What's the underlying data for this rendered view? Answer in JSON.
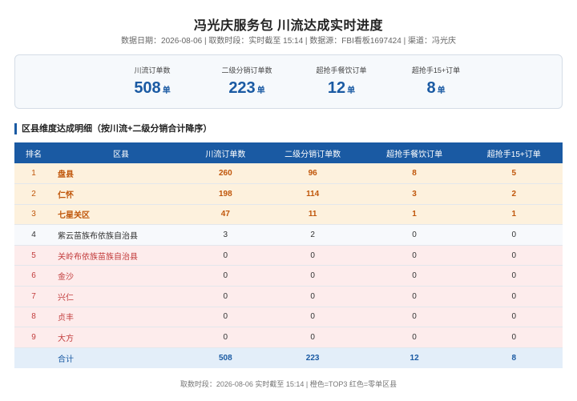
{
  "header": {
    "title": "冯光庆服务包 川流达成实时进度",
    "meta": "数据日期：2026-08-06 | 取数时段：实时截至 15:14 | 数据源：FBI看板1697424 | 渠道：冯光庆"
  },
  "kpis": [
    {
      "label": "川流订单数",
      "value": "508",
      "unit": "单"
    },
    {
      "label": "二级分销订单数",
      "value": "223",
      "unit": "单"
    },
    {
      "label": "超抢手餐饮订单",
      "value": "12",
      "unit": "单"
    },
    {
      "label": "超抢手15+订单",
      "value": "8",
      "unit": "单"
    }
  ],
  "section": {
    "title": "区县维度达成明细（按川流+二级分销合计降序）"
  },
  "table": {
    "headers": [
      "排名",
      "区县",
      "川流订单数",
      "二级分销订单数",
      "超抢手餐饮订单",
      "超抢手15+订单"
    ],
    "rows": [
      {
        "rank": "1",
        "name": "盘县",
        "c1": "260",
        "c2": "96",
        "c3": "8",
        "c4": "5",
        "type": "top3"
      },
      {
        "rank": "2",
        "name": "仁怀",
        "c1": "198",
        "c2": "114",
        "c3": "3",
        "c4": "2",
        "type": "top3"
      },
      {
        "rank": "3",
        "name": "七星关区",
        "c1": "47",
        "c2": "11",
        "c3": "1",
        "c4": "1",
        "type": "top3"
      },
      {
        "rank": "4",
        "name": "紫云苗族布依族自治县",
        "c1": "3",
        "c2": "2",
        "c3": "0",
        "c4": "0",
        "type": "normal"
      },
      {
        "rank": "5",
        "name": "关岭布依族苗族自治县",
        "c1": "0",
        "c2": "0",
        "c3": "0",
        "c4": "0",
        "type": "zero"
      },
      {
        "rank": "6",
        "name": "金沙",
        "c1": "0",
        "c2": "0",
        "c3": "0",
        "c4": "0",
        "type": "zero"
      },
      {
        "rank": "7",
        "name": "兴仁",
        "c1": "0",
        "c2": "0",
        "c3": "0",
        "c4": "0",
        "type": "zero"
      },
      {
        "rank": "8",
        "name": "贞丰",
        "c1": "0",
        "c2": "0",
        "c3": "0",
        "c4": "0",
        "type": "zero"
      },
      {
        "rank": "9",
        "name": "大方",
        "c1": "0",
        "c2": "0",
        "c3": "0",
        "c4": "0",
        "type": "zero"
      }
    ],
    "total": {
      "rank": "",
      "name": "合计",
      "c1": "508",
      "c2": "223",
      "c3": "12",
      "c4": "8"
    }
  },
  "footer": {
    "text": "取数时段：2026-08-06 实时截至 15:14 | 橙色=TOP3 红色=零单区县"
  },
  "colors": {
    "primary": "#1a5aa3",
    "top3_bg": "#fdf1dd",
    "top3_text": "#c0560a",
    "zero_bg": "#fdecec",
    "zero_text": "#c23c3c",
    "total_bg": "#e3eef9"
  }
}
